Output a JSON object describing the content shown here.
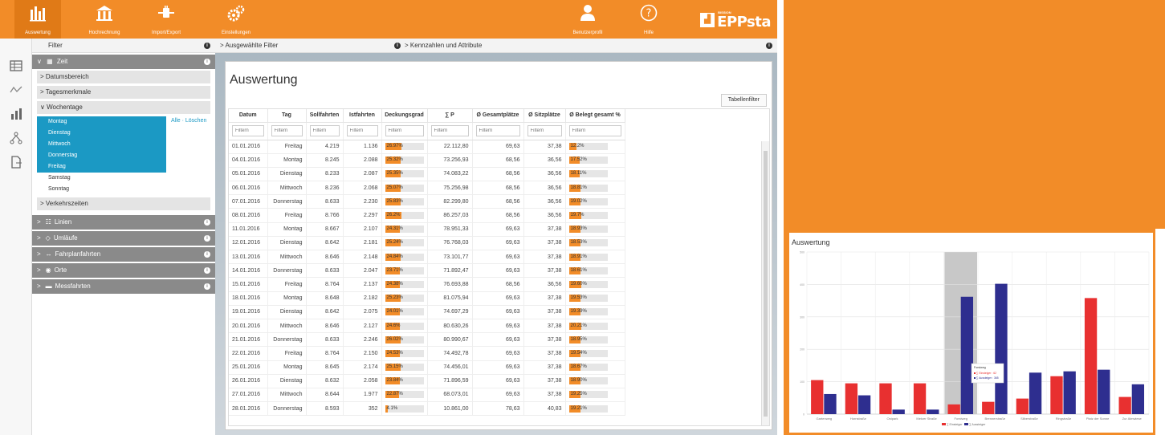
{
  "nav": [
    {
      "label": "Auswertung",
      "icon": "analysis-bars-icon",
      "active": true
    },
    {
      "label": "Hochrechnung",
      "icon": "building-columns-icon",
      "active": false
    },
    {
      "label": "Import/Export",
      "icon": "plug-transfer-icon",
      "active": false
    },
    {
      "label": "Einstellungen",
      "icon": "gears-icon",
      "active": false
    },
    {
      "label": "Benutzerprofil",
      "icon": "user-icon",
      "active": false
    },
    {
      "label": "Hilfe",
      "icon": "help-circle-icon",
      "active": false
    }
  ],
  "brand": {
    "small": "BISSION",
    "big": "EPPsta"
  },
  "rail_icons": [
    "table-icon",
    "line-chart-icon",
    "bar-chart-icon",
    "network-icon",
    "export-document-icon"
  ],
  "filters": {
    "header": "Filter",
    "zeit_label": "Zeit",
    "sub_items": [
      "Datumsbereich",
      "Tagesmerkmale"
    ],
    "wochentage_label": "Wochentage",
    "alle_loeschen": "Alle · Löschen",
    "days": [
      {
        "name": "Montag",
        "selected": true
      },
      {
        "name": "Dienstag",
        "selected": true
      },
      {
        "name": "Mittwoch",
        "selected": true
      },
      {
        "name": "Donnerstag",
        "selected": true
      },
      {
        "name": "Freitag",
        "selected": true
      },
      {
        "name": "Samstag",
        "selected": false
      },
      {
        "name": "Sonntag",
        "selected": false
      }
    ],
    "verkehrszeiten_label": "Verkehrszeiten",
    "groups": [
      "Linien",
      "Umläufe",
      "Fahrplanfahrten",
      "Orte",
      "Messfahrten"
    ]
  },
  "crumbs": {
    "left": "Ausgewählte Filter",
    "right": "Kennzahlen und Attribute"
  },
  "main": {
    "title": "Auswertung",
    "table_filter_button": "Tabellenfilter",
    "filter_placeholder": "Filtern",
    "columns": [
      "Datum",
      "Tag",
      "Sollfahrten",
      "Istfahrten",
      "Deckungsgrad",
      "∑ P",
      "Ø Gesamtplätze",
      "Ø Sitzplätze",
      "Ø Belegt gesamt %"
    ],
    "rows": [
      {
        "datum": "01.01.2016",
        "tag": "Freitag",
        "soll": "4.219",
        "ist": "1.136",
        "deckung": 26.9,
        "deckung_label": "26.97%",
        "p": "22.112,80",
        "gesamt": "69,63",
        "sitz": "37,38",
        "belegt": 12.2,
        "belegt_label": "12.2%"
      },
      {
        "datum": "04.01.2016",
        "tag": "Montag",
        "soll": "8.245",
        "ist": "2.088",
        "deckung": 25.3,
        "deckung_label": "25.32%",
        "p": "73.256,93",
        "gesamt": "68,56",
        "sitz": "36,56",
        "belegt": 17.5,
        "belegt_label": "17.52%"
      },
      {
        "datum": "05.01.2016",
        "tag": "Dienstag",
        "soll": "8.233",
        "ist": "2.087",
        "deckung": 25.3,
        "deckung_label": "25.35%",
        "p": "74.083,22",
        "gesamt": "68,56",
        "sitz": "36,56",
        "belegt": 18.1,
        "belegt_label": "18.11%"
      },
      {
        "datum": "06.01.2016",
        "tag": "Mittwoch",
        "soll": "8.236",
        "ist": "2.068",
        "deckung": 25.0,
        "deckung_label": "25.07%",
        "p": "75.256,98",
        "gesamt": "68,56",
        "sitz": "36,56",
        "belegt": 18.8,
        "belegt_label": "18.81%"
      },
      {
        "datum": "07.01.2016",
        "tag": "Donnerstag",
        "soll": "8.633",
        "ist": "2.230",
        "deckung": 25.8,
        "deckung_label": "25.83%",
        "p": "82.299,80",
        "gesamt": "68,56",
        "sitz": "36,56",
        "belegt": 19.0,
        "belegt_label": "19.02%"
      },
      {
        "datum": "08.01.2016",
        "tag": "Freitag",
        "soll": "8.766",
        "ist": "2.297",
        "deckung": 26.2,
        "deckung_label": "26.2%",
        "p": "86.257,03",
        "gesamt": "68,56",
        "sitz": "36,56",
        "belegt": 19.7,
        "belegt_label": "19.7%"
      },
      {
        "datum": "11.01.2016",
        "tag": "Montag",
        "soll": "8.667",
        "ist": "2.107",
        "deckung": 24.3,
        "deckung_label": "24.31%",
        "p": "78.951,33",
        "gesamt": "69,63",
        "sitz": "37,38",
        "belegt": 18.9,
        "belegt_label": "18.93%"
      },
      {
        "datum": "12.01.2016",
        "tag": "Dienstag",
        "soll": "8.642",
        "ist": "2.181",
        "deckung": 25.2,
        "deckung_label": "25.24%",
        "p": "76.768,03",
        "gesamt": "69,63",
        "sitz": "37,38",
        "belegt": 18.5,
        "belegt_label": "18.53%"
      },
      {
        "datum": "13.01.2016",
        "tag": "Mittwoch",
        "soll": "8.646",
        "ist": "2.148",
        "deckung": 24.8,
        "deckung_label": "24.84%",
        "p": "73.101,77",
        "gesamt": "69,63",
        "sitz": "37,38",
        "belegt": 18.9,
        "belegt_label": "18.91%"
      },
      {
        "datum": "14.01.2016",
        "tag": "Donnerstag",
        "soll": "8.633",
        "ist": "2.047",
        "deckung": 23.7,
        "deckung_label": "23.71%",
        "p": "71.892,47",
        "gesamt": "69,63",
        "sitz": "37,38",
        "belegt": 18.6,
        "belegt_label": "18.61%"
      },
      {
        "datum": "15.01.2016",
        "tag": "Freitag",
        "soll": "8.764",
        "ist": "2.137",
        "deckung": 24.3,
        "deckung_label": "24.38%",
        "p": "76.693,88",
        "gesamt": "68,56",
        "sitz": "36,56",
        "belegt": 19.6,
        "belegt_label": "19.60%"
      },
      {
        "datum": "18.01.2016",
        "tag": "Montag",
        "soll": "8.648",
        "ist": "2.182",
        "deckung": 25.2,
        "deckung_label": "25.23%",
        "p": "81.075,94",
        "gesamt": "69,63",
        "sitz": "37,38",
        "belegt": 19.5,
        "belegt_label": "19.53%"
      },
      {
        "datum": "19.01.2016",
        "tag": "Dienstag",
        "soll": "8.642",
        "ist": "2.075",
        "deckung": 24.0,
        "deckung_label": "24.01%",
        "p": "74.697,29",
        "gesamt": "69,63",
        "sitz": "37,38",
        "belegt": 19.3,
        "belegt_label": "19.39%"
      },
      {
        "datum": "20.01.2016",
        "tag": "Mittwoch",
        "soll": "8.646",
        "ist": "2.127",
        "deckung": 24.6,
        "deckung_label": "24.6%",
        "p": "80.630,26",
        "gesamt": "69,63",
        "sitz": "37,38",
        "belegt": 20.2,
        "belegt_label": "20.21%"
      },
      {
        "datum": "21.01.2016",
        "tag": "Donnerstag",
        "soll": "8.633",
        "ist": "2.246",
        "deckung": 26.0,
        "deckung_label": "26.02%",
        "p": "80.990,67",
        "gesamt": "69,63",
        "sitz": "37,38",
        "belegt": 18.9,
        "belegt_label": "18.95%"
      },
      {
        "datum": "22.01.2016",
        "tag": "Freitag",
        "soll": "8.764",
        "ist": "2.150",
        "deckung": 24.5,
        "deckung_label": "24.53%",
        "p": "74.492,78",
        "gesamt": "69,63",
        "sitz": "37,38",
        "belegt": 19.5,
        "belegt_label": "19.54%"
      },
      {
        "datum": "25.01.2016",
        "tag": "Montag",
        "soll": "8.645",
        "ist": "2.174",
        "deckung": 25.1,
        "deckung_label": "25.15%",
        "p": "74.456,01",
        "gesamt": "69,63",
        "sitz": "37,38",
        "belegt": 18.6,
        "belegt_label": "18.67%"
      },
      {
        "datum": "26.01.2016",
        "tag": "Dienstag",
        "soll": "8.632",
        "ist": "2.058",
        "deckung": 23.8,
        "deckung_label": "23.84%",
        "p": "71.896,59",
        "gesamt": "69,63",
        "sitz": "37,38",
        "belegt": 18.9,
        "belegt_label": "18.90%"
      },
      {
        "datum": "27.01.2016",
        "tag": "Mittwoch",
        "soll": "8.644",
        "ist": "1.977",
        "deckung": 22.8,
        "deckung_label": "22.87%",
        "p": "68.073,01",
        "gesamt": "69,63",
        "sitz": "37,38",
        "belegt": 19.2,
        "belegt_label": "19.25%"
      },
      {
        "datum": "28.01.2016",
        "tag": "Donnerstag",
        "soll": "8.593",
        "ist": "352",
        "deckung": 4.1,
        "deckung_label": "4.1%",
        "p": "10.861,00",
        "gesamt": "78,63",
        "sitz": "40,83",
        "belegt": 19.2,
        "belegt_label": "19.21%"
      }
    ]
  },
  "chart_data": {
    "type": "bar",
    "title": "Auswertung",
    "categories": [
      "Gartenweg",
      "Hornstraße",
      "Ostpark",
      "Metzer Straße",
      "Forstweg",
      "Brennerstraße",
      "Silberstraße",
      "Ringstraße",
      "Platz der Sonne",
      "Zur Almwiese"
    ],
    "series": [
      {
        "name": "Einsteiger",
        "values": [
          105,
          95,
          95,
          95,
          30,
          38,
          48,
          117,
          358,
          53
        ]
      },
      {
        "name": "∑ Aussteiger",
        "values": [
          62,
          58,
          14,
          14,
          362,
          402,
          128,
          132,
          137,
          92
        ]
      }
    ],
    "ylim": [
      0,
      500
    ],
    "yticks": [
      "0",
      "100",
      "200",
      "300",
      "400",
      "500"
    ],
    "highlight_category": "Forstweg",
    "tooltip": {
      "title": "Forstweg",
      "lines": [
        "∑ Einsteiger : 62",
        "∑ Aussteiger : 365"
      ]
    },
    "legend_labels": [
      "∑ Einsteiger",
      "∑ Aussteiger"
    ],
    "colors": {
      "einsteiger": "#e83030",
      "aussteiger": "#2e2e8f",
      "highlight": "#c8c8c8"
    }
  }
}
